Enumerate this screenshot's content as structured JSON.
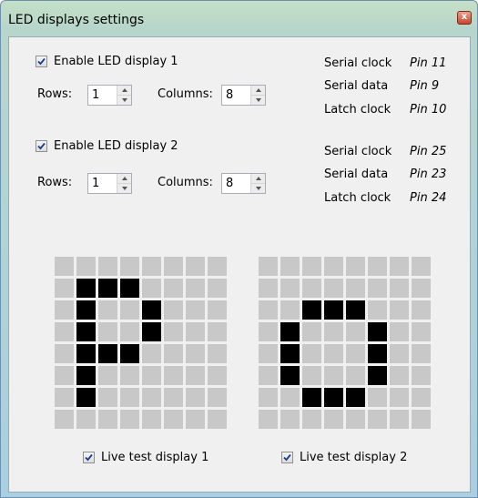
{
  "window": {
    "title": "LED displays settings",
    "close_label": "x"
  },
  "display1": {
    "enable_label": "Enable LED display 1",
    "enabled": true,
    "rows_label": "Rows:",
    "rows": "1",
    "columns_label": "Columns:",
    "columns": "8",
    "pins": [
      {
        "label": "Serial clock",
        "value": "Pin 11"
      },
      {
        "label": "Serial data",
        "value": "Pin 9"
      },
      {
        "label": "Latch clock",
        "value": "Pin 10"
      }
    ]
  },
  "display2": {
    "enable_label": "Enable LED display 2",
    "enabled": true,
    "rows_label": "Rows:",
    "rows": "1",
    "columns_label": "Columns:",
    "columns": "8",
    "pins": [
      {
        "label": "Serial clock",
        "value": "Pin 25"
      },
      {
        "label": "Serial data",
        "value": "Pin 23"
      },
      {
        "label": "Latch clock",
        "value": "Pin 24"
      }
    ]
  },
  "matrix1": [
    [
      0,
      0,
      0,
      0,
      0,
      0,
      0,
      0
    ],
    [
      0,
      1,
      1,
      1,
      0,
      0,
      0,
      0
    ],
    [
      0,
      1,
      0,
      0,
      1,
      0,
      0,
      0
    ],
    [
      0,
      1,
      0,
      0,
      1,
      0,
      0,
      0
    ],
    [
      0,
      1,
      1,
      1,
      0,
      0,
      0,
      0
    ],
    [
      0,
      1,
      0,
      0,
      0,
      0,
      0,
      0
    ],
    [
      0,
      1,
      0,
      0,
      0,
      0,
      0,
      0
    ],
    [
      0,
      0,
      0,
      0,
      0,
      0,
      0,
      0
    ]
  ],
  "matrix2": [
    [
      0,
      0,
      0,
      0,
      0,
      0,
      0,
      0
    ],
    [
      0,
      0,
      0,
      0,
      0,
      0,
      0,
      0
    ],
    [
      0,
      0,
      1,
      1,
      1,
      0,
      0,
      0
    ],
    [
      0,
      1,
      0,
      0,
      0,
      1,
      0,
      0
    ],
    [
      0,
      1,
      0,
      0,
      0,
      1,
      0,
      0
    ],
    [
      0,
      1,
      0,
      0,
      0,
      1,
      0,
      0
    ],
    [
      0,
      0,
      1,
      1,
      1,
      0,
      0,
      0
    ],
    [
      0,
      0,
      0,
      0,
      0,
      0,
      0,
      0
    ]
  ],
  "live_test": [
    {
      "label": "Live test display 1",
      "checked": true
    },
    {
      "label": "Live test display 2",
      "checked": true
    }
  ],
  "colors": {
    "led_on": "#000000",
    "led_off": "#c8c8c8",
    "dialog_bg": "#f0f0f0"
  }
}
